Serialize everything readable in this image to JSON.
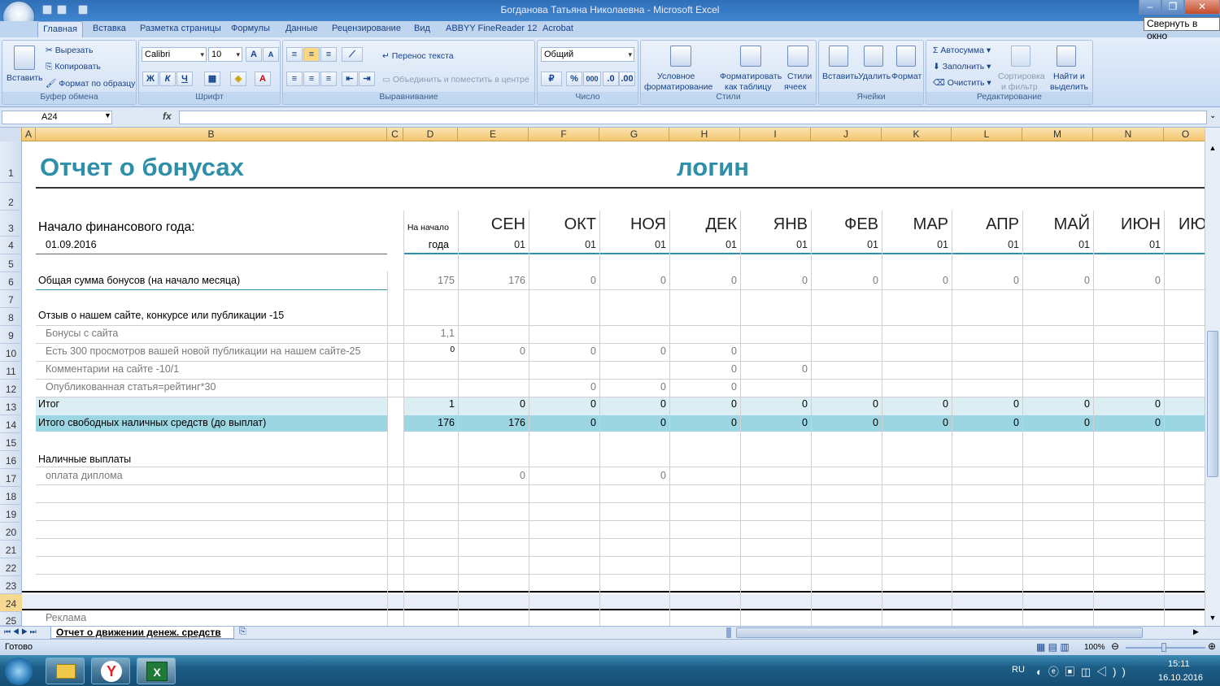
{
  "window": {
    "title": "Богданова Татьяна Николаевна - Microsoft Excel",
    "tooltip": "Свернуть в окно"
  },
  "tabs": [
    "Главная",
    "Вставка",
    "Разметка страницы",
    "Формулы",
    "Данные",
    "Рецензирование",
    "Вид",
    "ABBYY FineReader 12",
    "Acrobat"
  ],
  "ribbon": {
    "clipboard": {
      "paste": "Вставить",
      "cut": "Вырезать",
      "copy": "Копировать",
      "format_painter": "Формат по образцу",
      "label": "Буфер обмена"
    },
    "font": {
      "name": "Calibri",
      "size": "10",
      "bold": "Ж",
      "italic": "К",
      "underline": "Ч",
      "label": "Шрифт"
    },
    "alignment": {
      "wrap": "Перенос текста",
      "merge": "Объединить и поместить в центре",
      "label": "Выравнивание"
    },
    "number": {
      "format": "Общий",
      "percent": "%",
      "thousands": "000",
      "label": "Число"
    },
    "styles": {
      "conditional": "Условное",
      "conditional2": "форматирование",
      "as_table": "Форматировать",
      "as_table2": "как таблицу",
      "cell_styles": "Стили",
      "cell_styles2": "ячеек",
      "label": "Стили"
    },
    "cells": {
      "insert": "Вставить",
      "delete": "Удалить",
      "format": "Формат",
      "label": "Ячейки"
    },
    "editing": {
      "autosum": "Автосумма",
      "fill": "Заполнить",
      "clear": "Очистить",
      "sort": "Сортировка",
      "sort2": "и фильтр",
      "find": "Найти и",
      "find2": "выделить",
      "label": "Редактирование"
    }
  },
  "formula_bar": {
    "name_box": "A24",
    "fx": "fx",
    "value": ""
  },
  "columns": [
    "A",
    "B",
    "C",
    "D",
    "E",
    "F",
    "G",
    "H",
    "I",
    "J",
    "K",
    "L",
    "M",
    "N",
    "O"
  ],
  "rows": [
    "1",
    "2",
    "3",
    "4",
    "5",
    "6",
    "7",
    "8",
    "9",
    "10",
    "11",
    "12",
    "13",
    "14",
    "15",
    "16",
    "17",
    "18",
    "19",
    "20",
    "21",
    "22",
    "23",
    "24",
    "25"
  ],
  "sheet": {
    "title": "Отчет о  бонусах",
    "login_label": "логин",
    "fy_label": "Начало финансового года:",
    "fy_date": "01.09.2016",
    "d_header_1": "На начало",
    "d_header_2": "года",
    "months": [
      "СЕН",
      "ОКТ",
      "НОЯ",
      "ДЕК",
      "ЯНВ",
      "ФЕВ",
      "МАР",
      "АПР",
      "МАЙ",
      "ИЮН",
      "ИЮ"
    ],
    "month_days": [
      "01",
      "01",
      "01",
      "01",
      "01",
      "01",
      "01",
      "01",
      "01",
      "01"
    ],
    "r6": {
      "label": "Общая сумма бонусов (на начало месяца)",
      "values": [
        "175",
        "176",
        "0",
        "0",
        "0",
        "0",
        "0",
        "0",
        "0",
        "0",
        "0"
      ]
    },
    "r8": {
      "label": "Отзыв о нашем сайте, конкурсе или публикации -15"
    },
    "r9": {
      "label": "Бонусы с сайта",
      "values": [
        "1,1"
      ]
    },
    "r10": {
      "label": "Есть 300 просмотров вашей новой публикации  на нашем сайте-25",
      "values": [
        "0",
        "0",
        "0",
        "0",
        "0"
      ]
    },
    "r11": {
      "label": "Комментарии на сайте -10/1",
      "values": [
        "0",
        "0"
      ]
    },
    "r12": {
      "label": "Опубликованная статья=рейтинг*30",
      "values": [
        "0",
        "0",
        "0"
      ]
    },
    "r13": {
      "label": "Итог",
      "values": [
        "1",
        "0",
        "0",
        "0",
        "0",
        "0",
        "0",
        "0",
        "0",
        "0",
        "0"
      ]
    },
    "r14": {
      "label": "Итого свободных наличных средств (до выплат)",
      "values": [
        "176",
        "176",
        "0",
        "0",
        "0",
        "0",
        "0",
        "0",
        "0",
        "0",
        "0"
      ]
    },
    "r16": {
      "label": "Наличные выплаты"
    },
    "r17": {
      "label": "оплата диплома",
      "values": [
        "0",
        "0"
      ]
    },
    "r25": {
      "label": "Реклама"
    }
  },
  "sheet_tab": "Отчет о движении денеж. средств",
  "status": {
    "ready": "Готово",
    "zoom": "100%"
  },
  "taskbar": {
    "lang": "RU",
    "time": "15:11",
    "date": "16.10.2016"
  },
  "colors": {
    "accent": "#2e8fa8",
    "row13": "#daeef3",
    "row14": "#9dd6e3",
    "selection": "#e9eef8"
  }
}
